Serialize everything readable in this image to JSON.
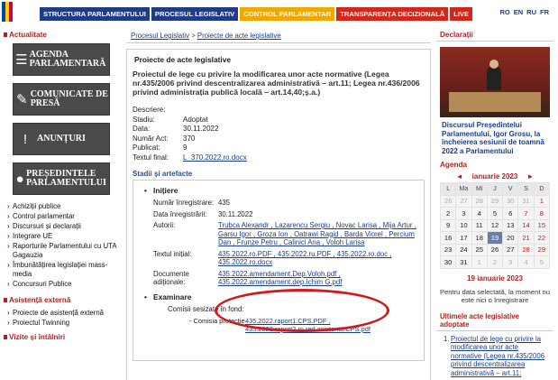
{
  "nav": {
    "items": [
      {
        "label": "STRUCTURA PARLAMENTULUI",
        "color": "#1f3c88"
      },
      {
        "label": "PROCESUL LEGISLATIV",
        "color": "#1f3c88"
      },
      {
        "label": "CONTROL PARLAMENTAR",
        "color": "#f0a800"
      },
      {
        "label": "TRANSPARENȚA DECIZIONALĂ",
        "color": "#d2281c"
      },
      {
        "label": "LIVE",
        "color": "#d2281c"
      }
    ],
    "langs": [
      "RO",
      "EN",
      "RU",
      "FR"
    ]
  },
  "left": {
    "section_title": "Actualitate",
    "tiles": [
      {
        "label": "AGENDA PARLAMENTARĂ",
        "icon": "list-icon"
      },
      {
        "label": "COMUNICATE DE PRESĂ",
        "icon": "pen-icon"
      },
      {
        "label": "ANUNȚURI",
        "icon": "exclamation-icon"
      },
      {
        "label": "PREȘEDINTELE PARLAMENTULUI",
        "icon": "person-icon"
      }
    ],
    "links": [
      "Achiziții publice",
      "Control parlamentar",
      "Discursuri și declarații",
      "Integrare UE",
      "Raporturile Parlamentului cu UTA Gagauzia",
      "Îmbunătățirea legislației mass-media",
      "Concursuri Publice"
    ],
    "section2_title": "Asistență externă",
    "links2": [
      "Proiecte de asistență externă",
      "Proiectul Twinning"
    ],
    "section3_title": "Vizite și întâlniri"
  },
  "center": {
    "breadcrumb": [
      "Procesul Legislativ",
      "Proiecte de acte legislative"
    ],
    "breadcrumb_sep": ">",
    "heading": "Proiecte de acte legislative",
    "law_title": "Proiectul de lege cu privire la modificarea unor acte normative (Legea nr.435/2006 privind descentralizarea administrativă – art.11; Legea nr.436/2006 privind administrația publică locală – art.14,40;ș.a.)",
    "fields": [
      {
        "k": "Descriere:",
        "v": ""
      },
      {
        "k": "Stadiu:",
        "v": "Adoptat"
      },
      {
        "k": "Data:",
        "v": "30.11.2022"
      },
      {
        "k": "Număr Act:",
        "v": "370"
      },
      {
        "k": "Publicat:",
        "v": "9"
      },
      {
        "k": "Textul final:",
        "v": "L_370.2022.ro.docx"
      }
    ],
    "stages_title": "Stadii și artefacte",
    "initiere": {
      "label": "Inițiere",
      "rows": [
        {
          "k": "Număr înregistrare:",
          "v": "435"
        },
        {
          "k": "Data înregistrării:",
          "v": "30.11.2022"
        },
        {
          "k": "Autorii:",
          "v": "Trubca Alexandr , Lazarencu Sergiu , Novac Larisa , Mija Artur , Garsu Igor , Groza Ion , Oatrawi Ragid , Barda Viorel , Percium Dan , Frunze Petru , Calinici Ana , Voloh Larisa"
        },
        {
          "k": "Textul inițial:",
          "v": "435.2022.ro.PDF , 435.2022.ru.PDF , 435.2022.ro.doc , 435.2022.ro.docx"
        },
        {
          "k": "Documente adiționale:",
          "v": "435.2022.amendament.Dep.Voloh.pdf , 435.2022.amendament.dep.Ichim G.pdf"
        }
      ]
    },
    "examinare": {
      "label": "Examinare",
      "commissions_label": "Comisii sesizate în fond:",
      "rows": [
        {
          "k": "- Comisia protecție",
          "v": "435.2022.raport1.CPS.PDF , 435.2022.raport2.ro.red.asistenta.CPS.pdf"
        }
      ]
    }
  },
  "right": {
    "declarations_title": "Declarații",
    "news_text": "Discursul Președintelui Parlamentului, Igor Grosu, la încheierea sesiunii de toamnă 2022 a Parlamentului",
    "agenda_title": "Agenda",
    "calendar": {
      "month_label": "ianuarie 2023",
      "prev": "◄",
      "next": "►",
      "dow": [
        "L",
        "Ma",
        "Mi",
        "J",
        "V",
        "S",
        "D"
      ],
      "weeks": [
        [
          "26",
          "27",
          "28",
          "29",
          "30",
          "31",
          "1"
        ],
        [
          "2",
          "3",
          "4",
          "5",
          "6",
          "7",
          "8"
        ],
        [
          "9",
          "10",
          "11",
          "12",
          "13",
          "14",
          "15"
        ],
        [
          "16",
          "17",
          "18",
          "19",
          "20",
          "21",
          "22"
        ],
        [
          "23",
          "24",
          "25",
          "26",
          "27",
          "28",
          "29"
        ],
        [
          "30",
          "31",
          "1",
          "2",
          "3",
          "4",
          "5"
        ]
      ],
      "today": "19"
    },
    "selected_date": "19 ianuarie 2023",
    "selected_msg": "Pentru data selectată, la moment nu este nici o înregistrare",
    "latest_title": "Ultimele acte legislative adoptate",
    "latest_items": [
      {
        "num": "1.",
        "text": "Proiectul de lege cu privire la modificarea unor acte normative (Legea nr.435/2006 privind descentralizarea administrativă – art.11;"
      }
    ]
  }
}
